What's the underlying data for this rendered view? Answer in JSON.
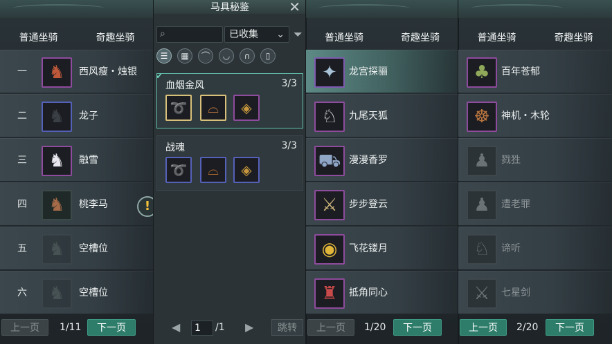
{
  "middle": {
    "title": "马具秘鉴",
    "search_placeholder": "",
    "filter_selected": "已收集",
    "sets": [
      {
        "name": "血烟金风",
        "count": "3/3"
      },
      {
        "name": "战魂",
        "count": "3/3"
      }
    ],
    "page_current": "1",
    "page_total": "/1",
    "jump_label": "跳转"
  },
  "left": {
    "tabs": [
      "普通坐骑",
      "奇趣坐骑"
    ],
    "rows": [
      {
        "num": "一",
        "name": "西风瘦・烛银"
      },
      {
        "num": "二",
        "name": "龙子"
      },
      {
        "num": "三",
        "name": "融雪"
      },
      {
        "num": "四",
        "name": "桃李马"
      },
      {
        "num": "五",
        "name": "空槽位"
      },
      {
        "num": "六",
        "name": "空槽位"
      }
    ],
    "prev_label": "上一页",
    "page": "1/11",
    "next_label": "下一页"
  },
  "right1": {
    "tabs": [
      "普通坐骑",
      "奇趣坐骑"
    ],
    "rows": [
      {
        "name": "龙宫探骊"
      },
      {
        "name": "九尾天狐"
      },
      {
        "name": "漫漫香罗"
      },
      {
        "name": "步步登云"
      },
      {
        "name": "飞花镂月"
      },
      {
        "name": "抵角同心"
      }
    ],
    "prev_label": "上一页",
    "page": "1/20",
    "next_label": "下一页"
  },
  "right2": {
    "tabs": [
      "普通坐骑",
      "奇趣坐骑"
    ],
    "rows": [
      {
        "name": "百年苍郁"
      },
      {
        "name": "神机・木轮"
      },
      {
        "name": "戮狌"
      },
      {
        "name": "遭老罪"
      },
      {
        "name": "谛听"
      },
      {
        "name": "七星剑"
      }
    ],
    "prev_label": "上一页",
    "page": "2/20",
    "next_label": "下一页"
  },
  "colors": {
    "accent": "#2e7d6b",
    "epic_border": "#8f4b9d",
    "rare_border": "#5560b8",
    "selected_set": "#62c2b0"
  }
}
